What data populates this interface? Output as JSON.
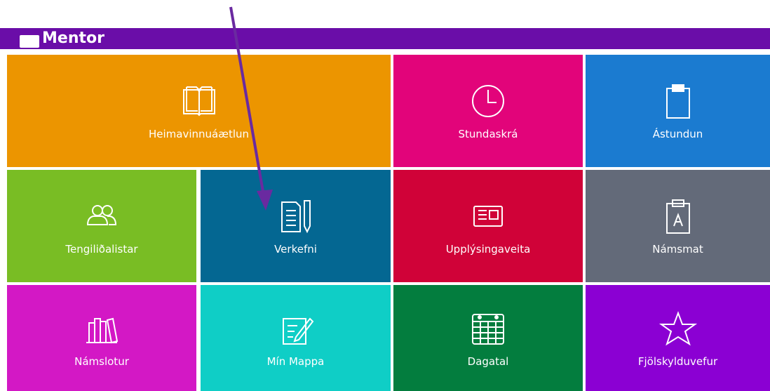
{
  "caption": "",
  "brand": "Mentor",
  "colors": {
    "topbar": "#6a0da8",
    "arrow": "#6a2aa0"
  },
  "tiles": [
    {
      "label": "Heimavinnuáætlun",
      "icon": "open-book-icon",
      "color": "#ec9500"
    },
    {
      "label": "Stundaskrá",
      "icon": "clock-icon",
      "color": "#e2047a"
    },
    {
      "label": "Ástundun",
      "icon": "clipboard-icon",
      "color": "#1b7bd0"
    },
    {
      "label": "Tengiliðalistar",
      "icon": "people-icon",
      "color": "#79bd24"
    },
    {
      "label": "Verkefni",
      "icon": "document-pen-icon",
      "color": "#046792"
    },
    {
      "label": "Upplýsingaveita",
      "icon": "newspaper-icon",
      "color": "#d00238"
    },
    {
      "label": "Námsmat",
      "icon": "clipboard-grade-icon",
      "color": "#636a79"
    },
    {
      "label": "Námslotur",
      "icon": "books-icon",
      "color": "#d318c5"
    },
    {
      "label": "Mín Mappa",
      "icon": "folder-edit-icon",
      "color": "#0fcec6"
    },
    {
      "label": "Dagatal",
      "icon": "calendar-icon",
      "color": "#037d3e"
    },
    {
      "label": "Fjölskylduvefur",
      "icon": "star-icon",
      "color": "#8b00d3"
    }
  ]
}
